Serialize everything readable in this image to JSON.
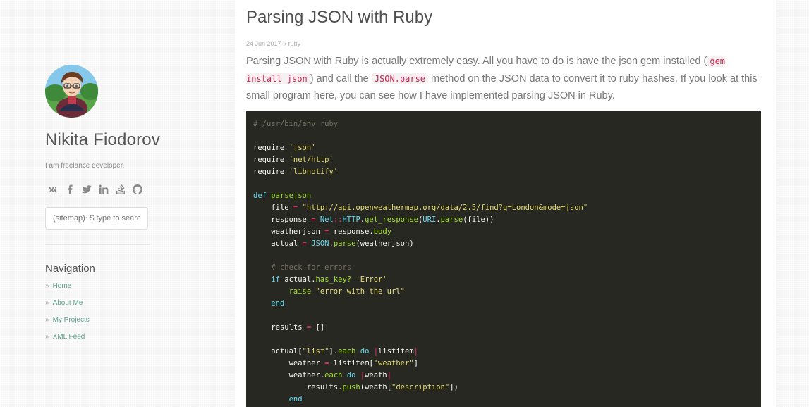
{
  "sidebar": {
    "author_name": "Nikita Fiodorov",
    "tagline": "I am freelance developer.",
    "social_icons": [
      "vk-icon",
      "facebook-icon",
      "twitter-icon",
      "linkedin-icon",
      "stackoverflow-icon",
      "github-icon"
    ],
    "search": {
      "placeholder": "(sitemap)~$ type to search"
    },
    "nav_title": "Navigation",
    "nav_items": [
      {
        "label": "Home"
      },
      {
        "label": "About Me"
      },
      {
        "label": "My Projects"
      },
      {
        "label": "XML Feed"
      }
    ],
    "nav_chevron": "»"
  },
  "post": {
    "title": "Parsing JSON with Ruby",
    "date": "24 Jun 2017",
    "meta_sep": "»",
    "tag": "ruby",
    "body": {
      "part1": "Parsing JSON with Ruby is actually extremely easy. All you have to do is have the json gem installed (",
      "code1": "gem install json",
      "part2": ") and call the ",
      "code2": "JSON.parse",
      "part3": " method on the JSON data to convert it to ruby hashes. If you look at this small program here, you can see how I have implemented parsing JSON in Ruby."
    },
    "code": {
      "shebang": "#!/usr/bin/env ruby",
      "req_kw": "require",
      "req1": "'json'",
      "req2": "'net/http'",
      "req3": "'libnotify'",
      "def_kw": "def",
      "fn_name": "parsejson",
      "file_var": "file",
      "url_str": "\"http://api.openweathermap.org/data/2.5/find?q=London&mode=json\"",
      "response_var": "response",
      "net_cls": "Net",
      "http_cls": "HTTP",
      "get_response": "get_response",
      "uri_cls": "URI",
      "parse_m": "parse",
      "weatherjson_var": "weatherjson",
      "body_m": "body",
      "actual_var": "actual",
      "json_cls": "JSON",
      "comment": "# check for errors",
      "if_kw": "if",
      "has_key": "has_key?",
      "error_str": "'Error'",
      "raise_m": "raise",
      "raise_str": "\"error with the url\"",
      "end_kw": "end",
      "results_var": "results",
      "list_str": "\"list\"",
      "each_m": "each",
      "do_kw": "do",
      "listitem": "listitem",
      "weather_var": "weather",
      "weather_str": "\"weather\"",
      "weath": "weath",
      "push_m": "push",
      "desc_str": "\"description\""
    }
  },
  "colors": {
    "code_bg": "#272822",
    "link": "#5a9e8c",
    "inline_code": "#c7254e"
  }
}
